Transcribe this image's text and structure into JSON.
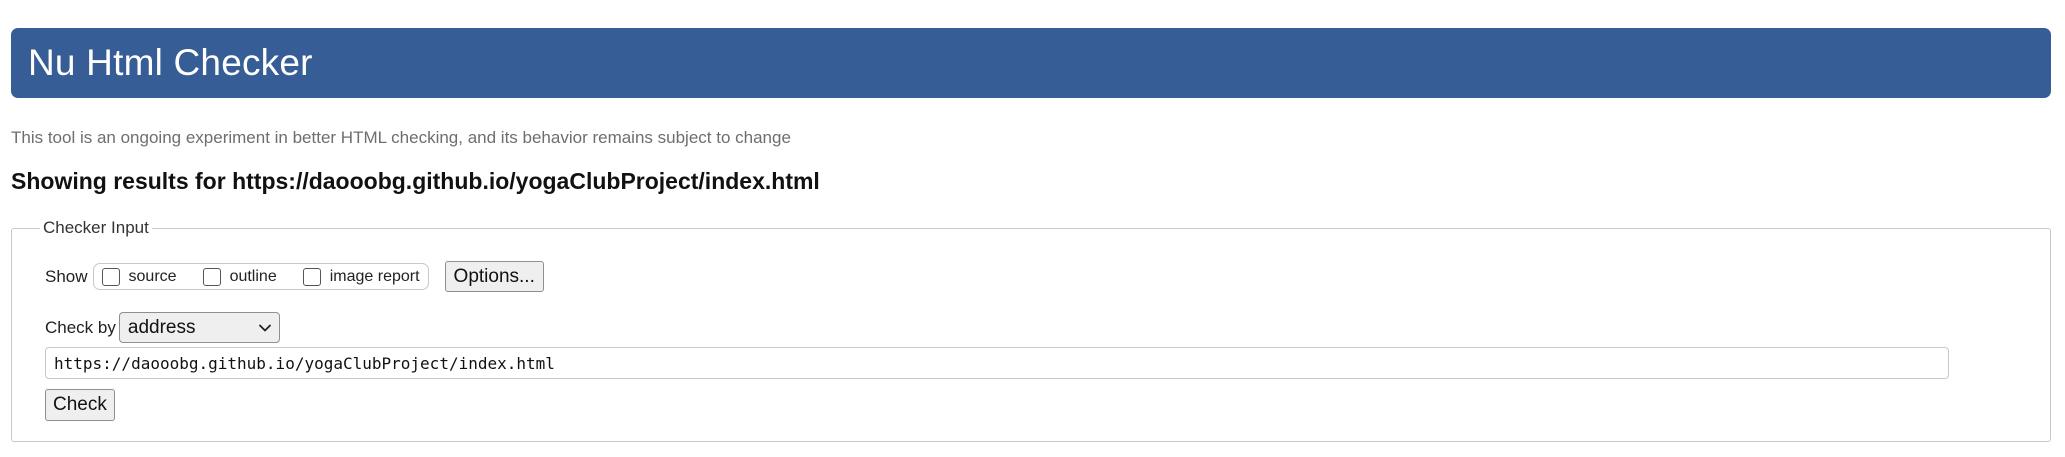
{
  "header": {
    "title": "Nu Html Checker"
  },
  "subtitle": "This tool is an ongoing experiment in better HTML checking, and its behavior remains subject to change",
  "results_heading": "Showing results for https://daooobg.github.io/yogaClubProject/index.html",
  "checker_input": {
    "legend": "Checker Input",
    "show_label": "Show",
    "show_options": [
      {
        "label": "source",
        "checked": false
      },
      {
        "label": "outline",
        "checked": false
      },
      {
        "label": "image report",
        "checked": false
      }
    ],
    "options_button": "Options...",
    "check_by_label": "Check by",
    "check_by_value": "address",
    "address_value": "https://daooobg.github.io/yogaClubProject/index.html",
    "check_button": "Check"
  },
  "colors": {
    "banner": "#365d95",
    "banner_text": "#ffffff"
  }
}
